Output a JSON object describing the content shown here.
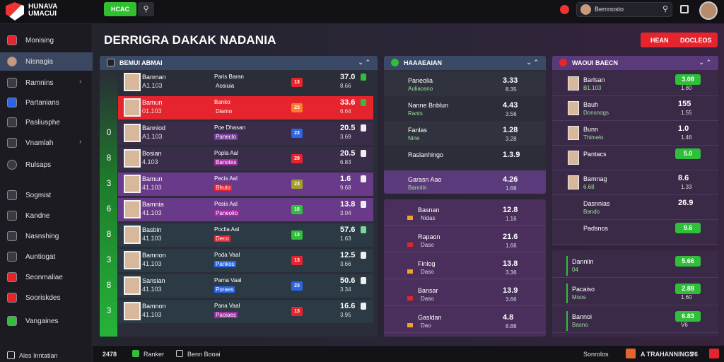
{
  "app": {
    "title": "HUNAVA UMACUI"
  },
  "topbar": {
    "green_button": "HCAC",
    "search_button_icon": "search-icon",
    "user_name": "Bernnosto",
    "user_search_icon": "search-icon"
  },
  "sidebar": {
    "items": [
      {
        "label": "Monising",
        "icon": "shield-icon",
        "chevron": ""
      },
      {
        "label": "Nisnagia",
        "icon": "user-icon",
        "chevron": ""
      },
      {
        "label": "Ramnins",
        "icon": "grid-icon",
        "chevron": "›"
      },
      {
        "label": "Partanians",
        "icon": "flag-icon",
        "chevron": ""
      },
      {
        "label": "Pasliusphe",
        "icon": "doc-icon",
        "chevron": ""
      },
      {
        "label": "Vnamlah",
        "icon": "arrow-icon",
        "chevron": "›"
      },
      {
        "label": "Rulsaps",
        "icon": "ball-icon",
        "chevron": ""
      },
      {
        "label": "Sogmist",
        "icon": "hand-icon",
        "chevron": ""
      },
      {
        "label": "Kandne",
        "icon": "list-icon",
        "chevron": ""
      },
      {
        "label": "Nasnshing",
        "icon": "box-icon",
        "chevron": ""
      },
      {
        "label": "Auntiogat",
        "icon": "table-icon",
        "chevron": ""
      },
      {
        "label": "Seonmaliae",
        "icon": "flag-icon",
        "chevron": ""
      },
      {
        "label": "Sooriskdes",
        "icon": "flag-icon",
        "chevron": ""
      },
      {
        "label": "Vangaines",
        "icon": "shield-icon",
        "chevron": ""
      }
    ],
    "footer_label": "Ales Inntatian"
  },
  "main": {
    "page_title": "DERRIGRA DAKAK NADANIA",
    "header_button": {
      "left": "HEAN",
      "right": "DOCLEOS"
    }
  },
  "left_panel": {
    "title": "BEMUI ABMAI",
    "controls": "⌄ ⌃",
    "rows": [
      {
        "num": "",
        "name": "Banman",
        "sub": "A1.103",
        "team": "Paris Baran",
        "tag": "Aosiuia",
        "badge": "13",
        "odds": "37.0",
        "odds2": "8.66",
        "row_bg": "#2b2d38",
        "tag_bg": "",
        "badge_color": "#e5242e",
        "sq_color": "#2fbf3a"
      },
      {
        "num": "",
        "name": "Bamun",
        "sub": "01.103",
        "team": "Banko",
        "tag": "Diamo",
        "badge": "23",
        "odds": "33.6",
        "odds2": "6.64",
        "row_bg": "#e5242e",
        "tag_bg": "",
        "badge_color": "#ff7a2a",
        "sq_color": "#2fbf3a"
      },
      {
        "num": "0",
        "name": "Banniod",
        "sub": "A1.103",
        "team": "Poe Dhasan",
        "tag": "Paneclo",
        "badge": "23",
        "odds": "20.5",
        "odds2": "3.69",
        "row_bg": "#3a2d4a",
        "tag_bg": "#7a3aa0",
        "badge_color": "#2a66e5",
        "sq_color": "#eee"
      },
      {
        "num": "8",
        "name": "Bosian",
        "sub": "4.103",
        "team": "Popla Aal",
        "tag": "Banotes",
        "badge": "28",
        "odds": "20.5",
        "odds2": "6.83",
        "row_bg": "#3a2d4a",
        "tag_bg": "#a02aa0",
        "badge_color": "#e5242e",
        "sq_color": "#eee"
      },
      {
        "num": "3",
        "name": "Bamun",
        "sub": "41.103",
        "team": "Pecis Aal",
        "tag": "Bhuto",
        "badge": "23",
        "odds": "1.6",
        "odds2": "9.68",
        "row_bg": "#6a3a8a",
        "tag_bg": "#e5242e",
        "badge_color": "#a0a02a",
        "sq_color": "#eee"
      },
      {
        "num": "6",
        "name": "Bamnia",
        "sub": "41.103",
        "team": "Pesis Aal",
        "tag": "Paneolio",
        "badge": "16",
        "odds": "13.8",
        "odds2": "3.04",
        "row_bg": "#6a3a8a",
        "tag_bg": "#a02aa0",
        "badge_color": "#2fbf3a",
        "sq_color": "#eee"
      },
      {
        "num": "8",
        "name": "Basbin",
        "sub": "41.103",
        "team": "Poclia Aal",
        "tag": "Deco",
        "badge": "13",
        "odds": "57.6",
        "odds2": "1.63",
        "row_bg": "#2b3a44",
        "tag_bg": "#e5242e",
        "badge_color": "#2fbf3a",
        "sq_color": "#7ad7a0"
      },
      {
        "num": "3",
        "name": "Bamnon",
        "sub": "41.103",
        "team": "Poda Vaal",
        "tag": "Pankos",
        "badge": "13",
        "odds": "12.5",
        "odds2": "3.66",
        "row_bg": "#2b3a44",
        "tag_bg": "#2a66e5",
        "badge_color": "#e5242e",
        "sq_color": "#eee"
      },
      {
        "num": "8",
        "name": "Sansian",
        "sub": "41.103",
        "team": "Pama Vaal",
        "tag": "Poraes",
        "badge": "23",
        "odds": "50.6",
        "odds2": "3.34",
        "row_bg": "#2b3a44",
        "tag_bg": "#2a66e5",
        "badge_color": "#2a66e5",
        "sq_color": "#eee"
      },
      {
        "num": "3",
        "name": "Bamnon",
        "sub": "41.103",
        "team": "Pana Vaal",
        "tag": "Paoiaes",
        "badge": "13",
        "odds": "16.6",
        "odds2": "3.95",
        "row_bg": "#2b3a44",
        "tag_bg": "#a02aa0",
        "badge_color": "#e5242e",
        "sq_color": "#eee"
      }
    ]
  },
  "middle_panel": {
    "title": "HAAAEAIAN",
    "controls": "⌄ ⌃",
    "rows": [
      {
        "name": "Paneolia",
        "sub": "Auliaosno",
        "value": "3.33",
        "value2": "8.35"
      },
      {
        "name": "Nanne Bnblun",
        "sub": "Rants",
        "value": "4.43",
        "value2": "3.56"
      },
      {
        "name": "Fanlas",
        "sub": "Nine",
        "value": "1.28",
        "value2": "3.28"
      },
      {
        "name": "Raslanhingo",
        "sub": "",
        "value": "1.3.9",
        "value2": ""
      },
      {
        "name": "Garasn Aao",
        "sub": "Bannlin",
        "value": "4.26",
        "value2": "1.68"
      }
    ]
  },
  "middle_lower_panel": {
    "rows": [
      {
        "name": "Basnan",
        "sub": "Nidas",
        "value": "12.8",
        "value2": "1.16"
      },
      {
        "name": "Rapaon",
        "sub": "Daso",
        "value": "21.6",
        "value2": "1.66"
      },
      {
        "name": "Finlog",
        "sub": "Daso",
        "value": "13.8",
        "value2": "3.36"
      },
      {
        "name": "Bansar",
        "sub": "Daso",
        "value": "13.9",
        "value2": "3.66"
      },
      {
        "name": "Gasldan",
        "sub": "Dao",
        "value": "4.8",
        "value2": "8.88"
      }
    ]
  },
  "right_panel": {
    "title": "WAOUI BAECN",
    "controls": "⌄ ⌃",
    "rows": [
      {
        "name": "Barlsan",
        "sub": "B1.103",
        "btn": "3.08",
        "value2": "1.80"
      },
      {
        "name": "Bauh",
        "sub": "Donsnogs",
        "btn": "",
        "value": "155",
        "value2": "1.55"
      },
      {
        "name": "Bunn",
        "sub": "Thimelo",
        "btn": "",
        "value": "1.0",
        "value2": "1.46"
      },
      {
        "name": "Pantacs",
        "sub": "",
        "btn": "5.0",
        "value2": ""
      },
      {
        "name": "Bamnag",
        "sub": "6.68",
        "btn": "",
        "value": "8.6",
        "value2": "1.33"
      },
      {
        "name": "Dasnnias",
        "sub": "Bando",
        "btn": "",
        "value": "26.9",
        "value2": ""
      },
      {
        "name": "Padsnos",
        "sub": "",
        "btn": "9.6",
        "value2": ""
      }
    ]
  },
  "right_lower_panel": {
    "rows": [
      {
        "name": "Dannlin",
        "sub": "04",
        "btn": "5.66",
        "value2": ""
      },
      {
        "name": "Pacaiso",
        "sub": "Moos",
        "btn": "2.88",
        "value2": "1.60"
      },
      {
        "name": "Bannoi",
        "sub": "Basno",
        "btn": "6.83",
        "value2": "V6"
      }
    ]
  },
  "footer": {
    "number": "2478",
    "label1": "Ranker",
    "label2": "Benn Booai",
    "label3": "Sonrolos",
    "label4": "A TRAHANNINGS",
    "label5": "V6"
  },
  "colors": {
    "accent_red": "#e5242e",
    "accent_green": "#2fbf3a",
    "purple": "#6a3a8a"
  }
}
